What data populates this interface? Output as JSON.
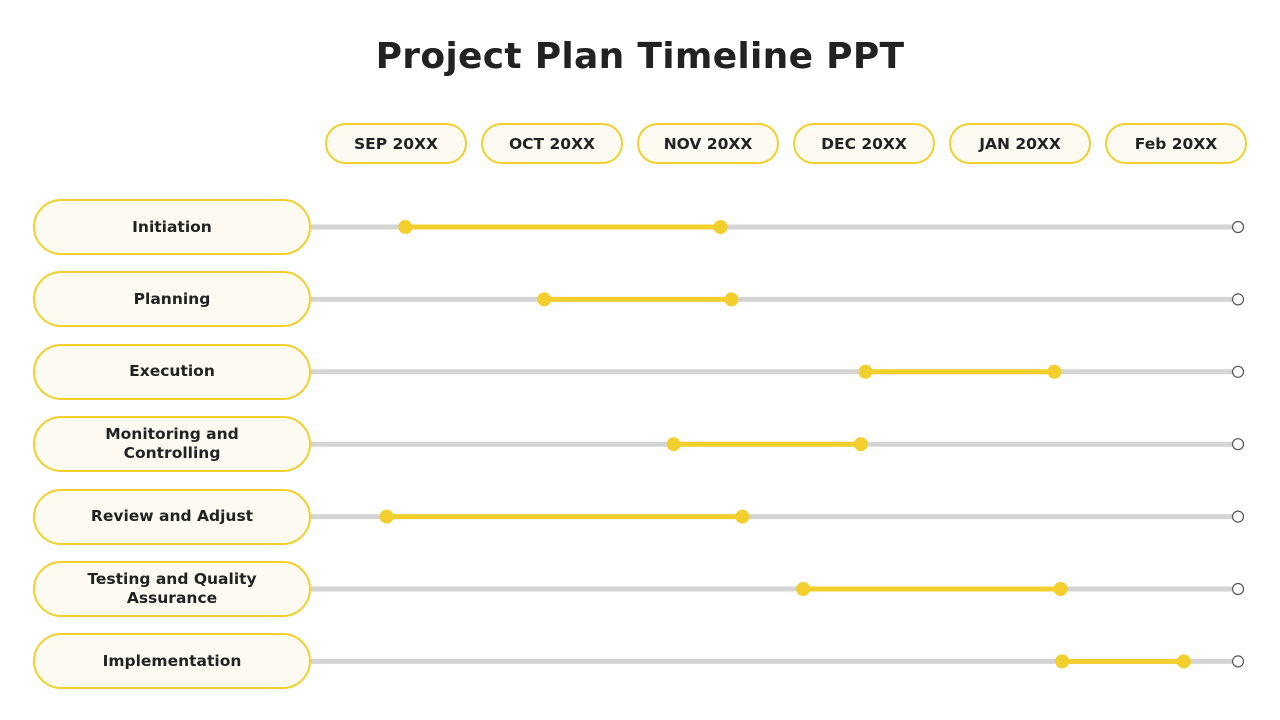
{
  "title": "Project Plan Timeline PPT",
  "colors": {
    "accent": "#f2cf2d",
    "pill_fill": "#fdfbf1",
    "track": "#d4d4d4",
    "text": "#222222",
    "end_marker": "#555555"
  },
  "chart_data": {
    "type": "gantt",
    "title": "Project Plan Timeline PPT",
    "months": [
      "SEP 20XX",
      "OCT 20XX",
      "NOV 20XX",
      "DEC 20XX",
      "JAN 20XX",
      "Feb 20XX"
    ],
    "x_unit": "month index (0 = SEP 20XX center, 5 = Feb 20XX center)",
    "x_range": [
      -0.55,
      5.4
    ],
    "tasks": [
      {
        "name": "Initiation",
        "start": 0.06,
        "end": 2.08
      },
      {
        "name": "Planning",
        "start": 0.95,
        "end": 2.15
      },
      {
        "name": "Execution",
        "start": 3.01,
        "end": 4.22
      },
      {
        "name": "Monitoring and Controlling",
        "start": 1.78,
        "end": 2.98
      },
      {
        "name": "Review and Adjust",
        "start": -0.06,
        "end": 2.22
      },
      {
        "name": "Testing and Quality Assurance",
        "start": 2.61,
        "end": 4.26
      },
      {
        "name": "Implementation",
        "start": 4.27,
        "end": 5.05
      }
    ]
  }
}
